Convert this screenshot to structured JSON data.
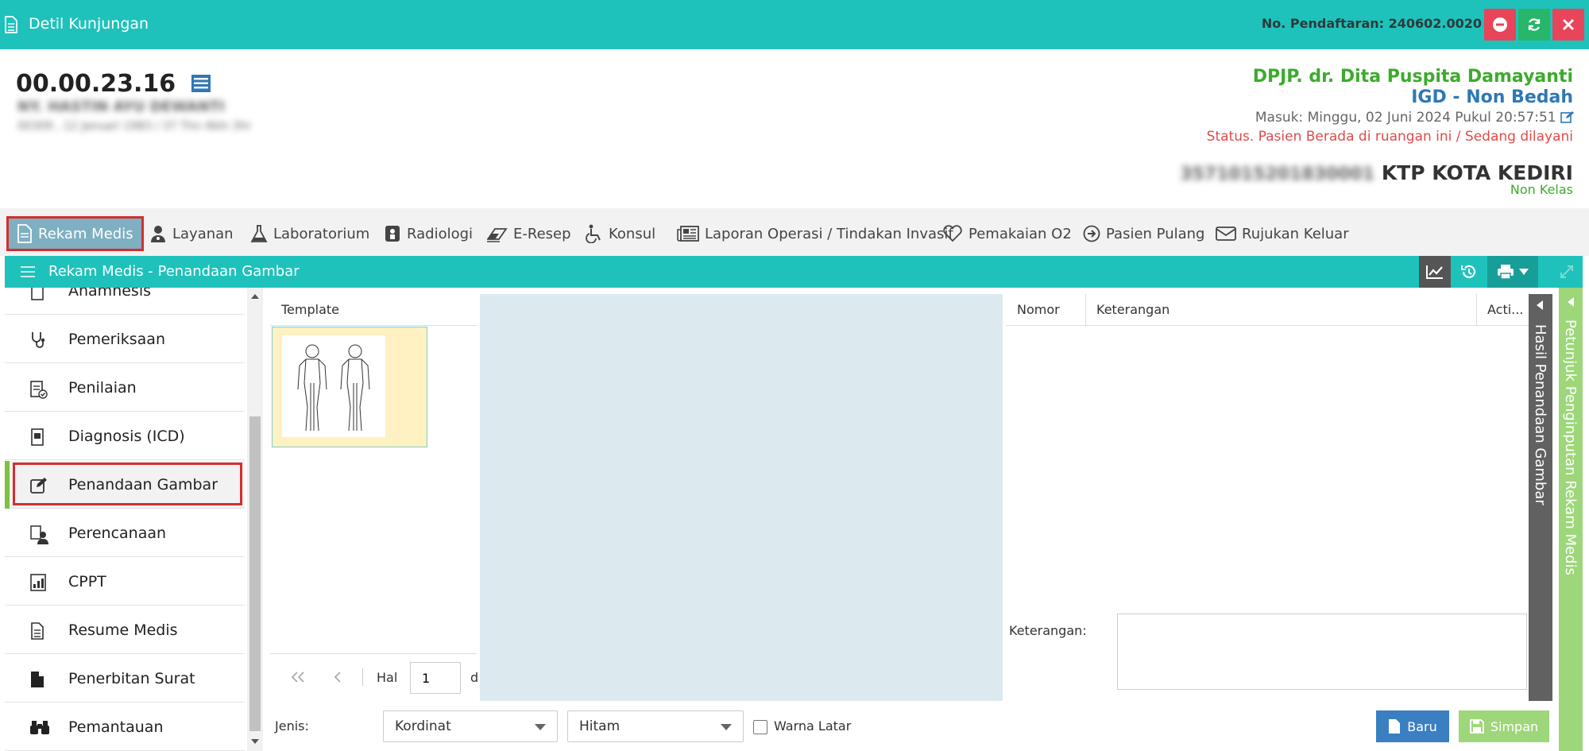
{
  "titlebar": {
    "title": "Detil Kunjungan",
    "registration_label": "No. Pendaftaran: 240602.0020",
    "icons": [
      "document-icon",
      "minus-circle-icon",
      "refresh-icon",
      "close-icon"
    ],
    "colors": {
      "bar": "#1ec2bb",
      "minus": "#e8445a",
      "refresh": "#27b66a",
      "close": "#e8445a"
    }
  },
  "patient": {
    "id": "00.00.23.16",
    "name_blurred": "NY. HASTIN AYU DEWANTI",
    "dob_blurred": "00309 , 12 Januari 1983 / 37 Thn 4bln 3hr",
    "nik_blurred": "3571015201830001",
    "doctor": "DPJP. dr. Dita Puspita Damayanti",
    "unit": "IGD - Non Bedah",
    "entry": "Masuk: Minggu, 02 Juni 2024 Pukul 20:57:51",
    "status": "Status. Pasien Berada di ruangan ini / Sedang dilayani",
    "ktp": "KTP KOTA KEDIRI",
    "class": "Non Kelas"
  },
  "tabs": [
    {
      "label": "Rekam Medis",
      "icon": "document-icon"
    },
    {
      "label": "Layanan",
      "icon": "user-doctor-icon"
    },
    {
      "label": "Laboratorium",
      "icon": "flask-icon"
    },
    {
      "label": "Radiologi",
      "icon": "xray-icon"
    },
    {
      "label": "E-Resep",
      "icon": "eraser-icon"
    },
    {
      "label": "Konsul",
      "icon": "wheelchair-icon"
    },
    {
      "label": "Laporan Operasi / Tindakan Invasif",
      "icon": "newspaper-icon"
    },
    {
      "label": "Pemakaian O2",
      "icon": "heart-icon"
    },
    {
      "label": "Pasien Pulang",
      "icon": "arrow-circle-right-icon"
    },
    {
      "label": "Rujukan Keluar",
      "icon": "envelope-icon"
    }
  ],
  "panel": {
    "title": "Rekam Medis - Penandaan Gambar"
  },
  "menu": [
    {
      "label": "Anamnesis",
      "icon": "clipboard-icon"
    },
    {
      "label": "Pemeriksaan",
      "icon": "stethoscope-icon"
    },
    {
      "label": "Penilaian",
      "icon": "clipboard-check-icon"
    },
    {
      "label": "Diagnosis (ICD)",
      "icon": "file-medical-icon"
    },
    {
      "label": "Penandaan Gambar",
      "icon": "edit-icon"
    },
    {
      "label": "Perencanaan",
      "icon": "user-plan-icon"
    },
    {
      "label": "CPPT",
      "icon": "chart-file-icon"
    },
    {
      "label": "Resume Medis",
      "icon": "file-text-icon"
    },
    {
      "label": "Penerbitan Surat",
      "icon": "file-icon"
    },
    {
      "label": "Pemantauan",
      "icon": "binoculars-icon"
    }
  ],
  "template": {
    "header": "Template",
    "pager_label": "Hal",
    "page_value": "1",
    "pager_suffix": "d"
  },
  "results": {
    "col_nomor": "Nomor",
    "col_keterangan": "Keterangan",
    "col_action": "Acti...",
    "keterangan_label": "Keterangan:",
    "side_tab": "Hasil Penandaan Gambar",
    "help_tab": "Petunjuk Penginputan Rekam Medis"
  },
  "bottom": {
    "jenis_label": "Jenis:",
    "jenis_value": "Kordinat",
    "color_value": "Hitam",
    "warna_label": "Warna Latar",
    "baru_label": "Baru",
    "simpan_label": "Simpan",
    "colors": {
      "baru": "#3a7fc1",
      "simpan": "#9ed67a"
    }
  }
}
